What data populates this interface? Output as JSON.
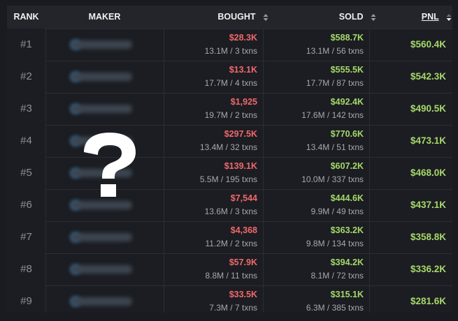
{
  "header": {
    "rank": "RANK",
    "maker": "MAKER",
    "bought": "BOUGHT",
    "sold": "SOLD",
    "pnl": "PNL"
  },
  "txn_unit": "txns",
  "rows": [
    {
      "rank": "#1",
      "bought_usd": "$28.3K",
      "bought_tokens": "13.1M",
      "bought_txns": "3",
      "sold_usd": "$588.7K",
      "sold_tokens": "13.1M",
      "sold_txns": "56",
      "pnl": "$560.4K"
    },
    {
      "rank": "#2",
      "bought_usd": "$13.1K",
      "bought_tokens": "17.7M",
      "bought_txns": "4",
      "sold_usd": "$555.5K",
      "sold_tokens": "17.7M",
      "sold_txns": "87",
      "pnl": "$542.3K"
    },
    {
      "rank": "#3",
      "bought_usd": "$1,925",
      "bought_tokens": "19.7M",
      "bought_txns": "2",
      "sold_usd": "$492.4K",
      "sold_tokens": "17.6M",
      "sold_txns": "142",
      "pnl": "$490.5K"
    },
    {
      "rank": "#4",
      "bought_usd": "$297.5K",
      "bought_tokens": "13.4M",
      "bought_txns": "32",
      "sold_usd": "$770.6K",
      "sold_tokens": "13.4M",
      "sold_txns": "51",
      "pnl": "$473.1K"
    },
    {
      "rank": "#5",
      "bought_usd": "$139.1K",
      "bought_tokens": "5.5M",
      "bought_txns": "195",
      "sold_usd": "$607.2K",
      "sold_tokens": "10.0M",
      "sold_txns": "337",
      "pnl": "$468.0K"
    },
    {
      "rank": "#6",
      "bought_usd": "$7,544",
      "bought_tokens": "13.6M",
      "bought_txns": "3",
      "sold_usd": "$444.6K",
      "sold_tokens": "9.9M",
      "sold_txns": "49",
      "pnl": "$437.1K"
    },
    {
      "rank": "#7",
      "bought_usd": "$4,368",
      "bought_tokens": "11.2M",
      "bought_txns": "2",
      "sold_usd": "$363.2K",
      "sold_tokens": "9.8M",
      "sold_txns": "134",
      "pnl": "$358.8K"
    },
    {
      "rank": "#8",
      "bought_usd": "$57.9K",
      "bought_tokens": "8.8M",
      "bought_txns": "11",
      "sold_usd": "$394.2K",
      "sold_tokens": "8.1M",
      "sold_txns": "72",
      "pnl": "$336.2K"
    },
    {
      "rank": "#9",
      "bought_usd": "$33.5K",
      "bought_tokens": "7.3M",
      "bought_txns": "7",
      "sold_usd": "$315.1K",
      "sold_tokens": "6.3M",
      "sold_txns": "385",
      "pnl": "$281.6K"
    }
  ],
  "overlay": {
    "icon": "question-mark-icon",
    "glyph": "?"
  },
  "colors": {
    "negative": "#f0686c",
    "positive": "#a6d86a",
    "background": "#1c1d22"
  }
}
